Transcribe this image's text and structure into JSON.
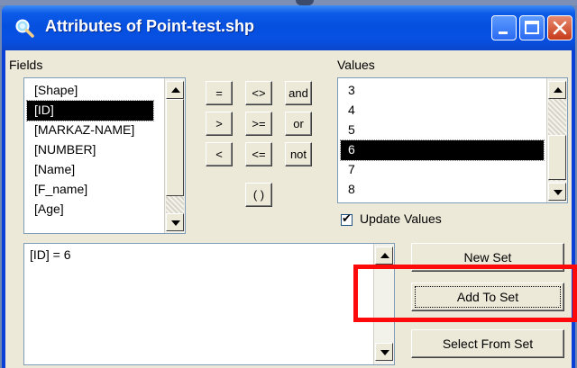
{
  "window": {
    "title": "Attributes of Point-test.shp",
    "controls": [
      "minimize",
      "maximize",
      "close"
    ]
  },
  "fields": {
    "label": "Fields",
    "items": [
      "[Shape]",
      "[ID]",
      "[MARKAZ-NAME]",
      "[NUMBER]",
      "[Name]",
      "[F_name]",
      "[Age]"
    ],
    "selected": "[ID]"
  },
  "operators": {
    "eq": "=",
    "ne": "<>",
    "and": "and",
    "gt": ">",
    "ge": ">=",
    "or": "or",
    "lt": "<",
    "le": "<=",
    "not": "not",
    "parens": "( )"
  },
  "values": {
    "label": "Values",
    "items": [
      "3",
      "4",
      "5",
      "6",
      "7",
      "8"
    ],
    "selected": "6",
    "update_values_label": "Update Values",
    "update_values_checked": true
  },
  "expression": "[ID] = 6",
  "actions": {
    "new_set": "New Set",
    "add_to_set": "Add To Set",
    "select_from_set": "Select From Set"
  },
  "highlight_color": "#ff0a0a"
}
